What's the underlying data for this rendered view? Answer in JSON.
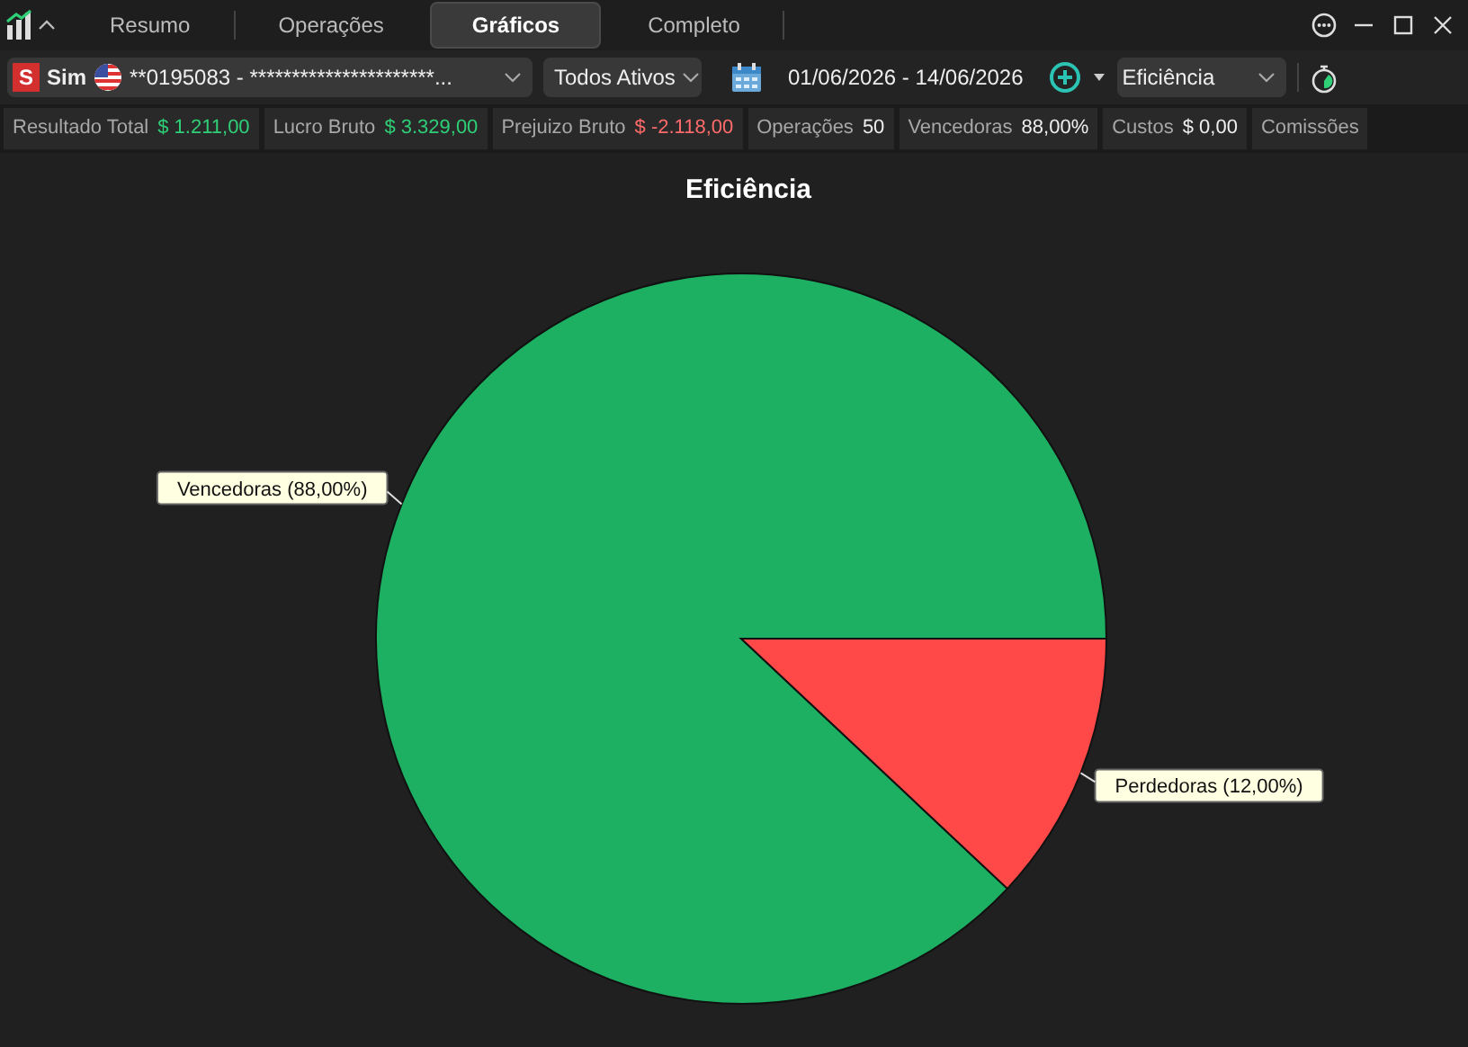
{
  "tabs": [
    {
      "label": "Resumo",
      "selected": false
    },
    {
      "label": "Operações",
      "selected": false
    },
    {
      "label": "Gráficos",
      "selected": true
    },
    {
      "label": "Completo",
      "selected": false
    }
  ],
  "toolbar": {
    "account_badge": "S",
    "account_type": "Sim",
    "account": "**0195083 - **********************...",
    "assets": "Todos Ativos",
    "date_range": "01/06/2026 - 14/06/2026",
    "chart_select": "Eficiência"
  },
  "stats": [
    {
      "label": "Resultado Total",
      "value": "$ 1.211,00",
      "kind": "positive"
    },
    {
      "label": "Lucro Bruto",
      "value": "$ 3.329,00",
      "kind": "positive"
    },
    {
      "label": "Prejuizo Bruto",
      "value": "$ -2.118,00",
      "kind": "negative"
    },
    {
      "label": "Operações",
      "value": "50",
      "kind": "neutral"
    },
    {
      "label": "Vencedoras",
      "value": "88,00%",
      "kind": "neutral"
    },
    {
      "label": "Custos",
      "value": "$ 0,00",
      "kind": "neutral"
    },
    {
      "label": "Comissões"
    }
  ],
  "chart_data": {
    "type": "pie",
    "title": "Eficiência",
    "categories": [
      "Vencedoras (88,00%)",
      "Perdedoras (12,00%)"
    ],
    "values": [
      88,
      12
    ],
    "colors": [
      "#1eb062",
      "#ff4848"
    ]
  }
}
